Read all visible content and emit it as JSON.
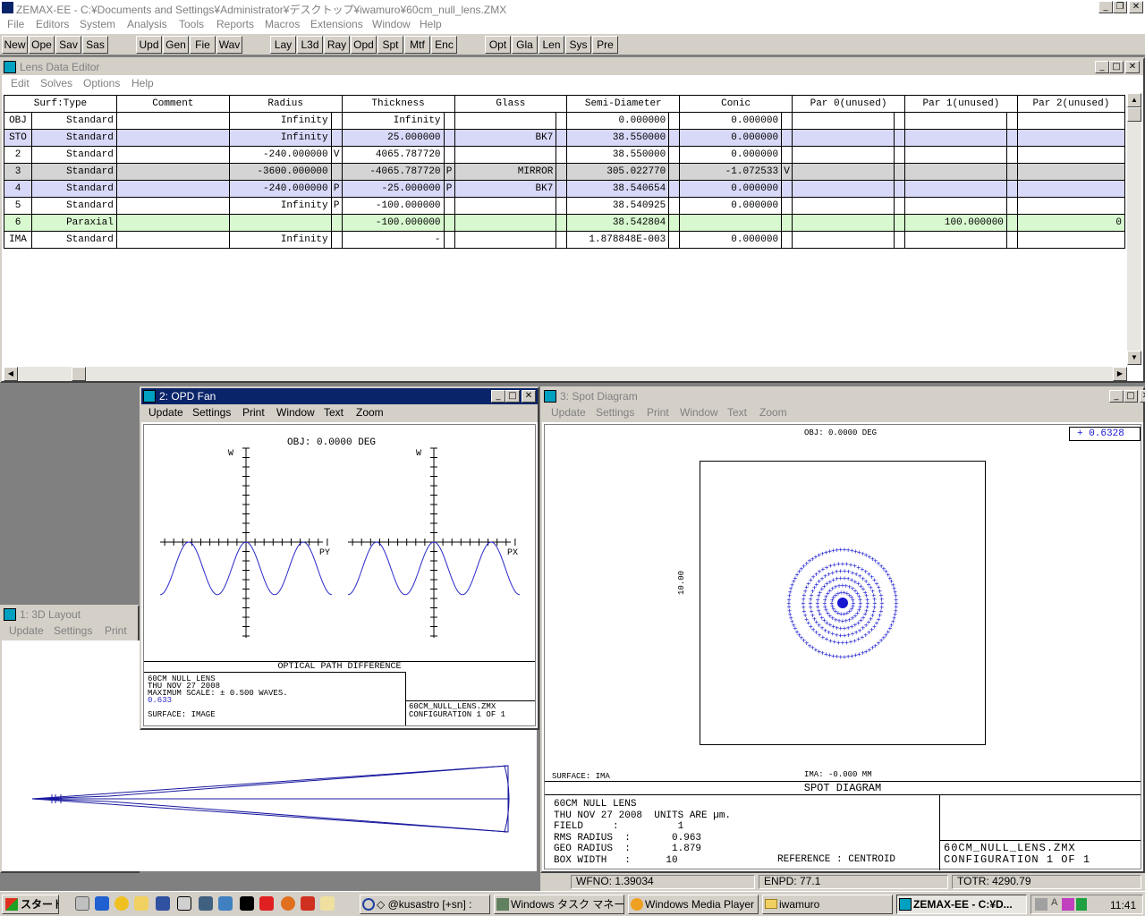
{
  "app": {
    "title": "ZEMAX-EE - C:¥Documents and Settings¥Administrator¥デスクトップ¥iwamuro¥60cm_null_lens.ZMX",
    "menu": [
      "File",
      "Editors",
      "System",
      "Analysis",
      "Tools",
      "Reports",
      "Macros",
      "Extensions",
      "Window",
      "Help"
    ]
  },
  "toolbar": {
    "group1": [
      "New",
      "Ope",
      "Sav",
      "Sas"
    ],
    "group2": [
      "Upd",
      "Gen",
      "Fie",
      "Wav"
    ],
    "group3": [
      "Lay",
      "L3d",
      "Ray",
      "Opd",
      "Spt",
      "Mtf",
      "Enc"
    ],
    "group4": [
      "Opt",
      "Gla",
      "Len",
      "Sys",
      "Pre"
    ]
  },
  "lde": {
    "title": "Lens Data Editor",
    "menu": [
      "Edit",
      "Solves",
      "Options",
      "Help"
    ],
    "headers": [
      "Surf:Type",
      "Comment",
      "Radius",
      "Thickness",
      "Glass",
      "Semi-Diameter",
      "Conic",
      "Par 0(unused)",
      "Par 1(unused)",
      "Par 2(unused)"
    ],
    "rows": [
      {
        "surf": "OBJ",
        "type": "Standard",
        "comment": "",
        "radius": "Infinity",
        "rs": "",
        "thickness": "Infinity",
        "ts": "",
        "glass": "",
        "gs": "",
        "semi": "0.000000",
        "ss": "",
        "conic": "0.000000",
        "cs": "",
        "p0": "",
        "p1": "",
        "p2": "",
        "bg": "#ffffff"
      },
      {
        "surf": "STO",
        "type": "Standard",
        "comment": "",
        "radius": "Infinity",
        "rs": "",
        "thickness": "25.000000",
        "ts": "",
        "glass": "BK7",
        "gs": "",
        "semi": "38.550000",
        "ss": "",
        "conic": "0.000000",
        "cs": "",
        "p0": "",
        "p1": "",
        "p2": "",
        "bg": "#d8d8f8"
      },
      {
        "surf": "2",
        "type": "Standard",
        "comment": "",
        "radius": "-240.000000",
        "rs": "V",
        "thickness": "4065.787720",
        "ts": "",
        "glass": "",
        "gs": "",
        "semi": "38.550000",
        "ss": "",
        "conic": "0.000000",
        "cs": "",
        "p0": "",
        "p1": "",
        "p2": "",
        "bg": "#ffffff"
      },
      {
        "surf": "3",
        "type": "Standard",
        "comment": "",
        "radius": "-3600.000000",
        "rs": "",
        "thickness": "-4065.787720",
        "ts": "P",
        "glass": "MIRROR",
        "gs": "",
        "semi": "305.022770",
        "ss": "",
        "conic": "-1.072533",
        "cs": "V",
        "p0": "",
        "p1": "",
        "p2": "",
        "bg": "#d4d4d4"
      },
      {
        "surf": "4",
        "type": "Standard",
        "comment": "",
        "radius": "-240.000000",
        "rs": "P",
        "thickness": "-25.000000",
        "ts": "P",
        "glass": "BK7",
        "gs": "",
        "semi": "38.540654",
        "ss": "",
        "conic": "0.000000",
        "cs": "",
        "p0": "",
        "p1": "",
        "p2": "",
        "bg": "#d8d8f8"
      },
      {
        "surf": "5",
        "type": "Standard",
        "comment": "",
        "radius": "Infinity",
        "rs": "P",
        "thickness": "-100.000000",
        "ts": "",
        "glass": "",
        "gs": "",
        "semi": "38.540925",
        "ss": "",
        "conic": "0.000000",
        "cs": "",
        "p0": "",
        "p1": "",
        "p2": "",
        "bg": "#ffffff"
      },
      {
        "surf": "6",
        "type": "Paraxial",
        "comment": "",
        "radius": "",
        "rs": "",
        "thickness": "-100.000000",
        "ts": "",
        "glass": "",
        "gs": "",
        "semi": "38.542804",
        "ss": "",
        "conic": "",
        "cs": "",
        "p0": "",
        "p1": "100.000000",
        "p2": "0",
        "bg": "#d8f8d0"
      },
      {
        "surf": "IMA",
        "type": "Standard",
        "comment": "",
        "radius": "Infinity",
        "rs": "",
        "thickness": "-",
        "ts": "",
        "glass": "",
        "gs": "",
        "semi": "1.878848E-003",
        "ss": "",
        "conic": "0.000000",
        "cs": "",
        "p0": "",
        "p1": "",
        "p2": "",
        "bg": "#ffffff"
      }
    ]
  },
  "opd": {
    "title": "2: OPD Fan",
    "menu": [
      "Update",
      "Settings",
      "Print",
      "Window",
      "Text",
      "Zoom"
    ],
    "obj": "OBJ: 0.0000 DEG",
    "w_label": "W",
    "py_label": "PY",
    "px_label": "PX",
    "caption": "OPTICAL PATH DIFFERENCE",
    "info": [
      "60CM NULL LENS",
      "THU NOV 27 2008",
      "MAXIMUM SCALE: ± 0.500 WAVES."
    ],
    "wavelength": "0.633",
    "surface": "SURFACE: IMAGE",
    "file": "60CM_NULL_LENS.ZMX",
    "config": "CONFIGURATION 1 OF 1",
    "curve_color": "#2828c8"
  },
  "layout": {
    "title": "1: 3D Layout",
    "menu": [
      "Update",
      "Settings",
      "Print"
    ]
  },
  "spot": {
    "title": "3: Spot Diagram",
    "menu": [
      "Update",
      "Settings",
      "Print",
      "Window",
      "Text",
      "Zoom"
    ],
    "obj": "OBJ: 0.0000 DEG",
    "legend": "+ 0.6328",
    "box_label": "10.00",
    "surface": "SURFACE: IMA",
    "ima": "IMA: -0.000 MM",
    "caption": "SPOT DIAGRAM",
    "info": [
      "60CM NULL LENS",
      "THU NOV 27 2008  UNITS ARE µm.",
      "FIELD     :          1",
      "RMS RADIUS  :       0.963",
      "GEO RADIUS  :       1.879",
      "BOX WIDTH   :      10"
    ],
    "reference": "REFERENCE  : CENTROID",
    "file": "60CM_NULL_LENS.ZMX",
    "config": "CONFIGURATION 1 OF 1",
    "dot_color": "#1818d0"
  },
  "status": {
    "wfno": "WFNO: 1.39034",
    "enpd": "ENPD: 77.1",
    "totr": "TOTR: 4290.79"
  },
  "taskbar": {
    "start": "スタート",
    "tasks": [
      "◇ @kusastro [+sn] :",
      "Windows タスク マネージ...",
      "Windows Media Player",
      "iwamuro",
      "ZEMAX-EE - C:¥D..."
    ],
    "clock": "11:41"
  }
}
